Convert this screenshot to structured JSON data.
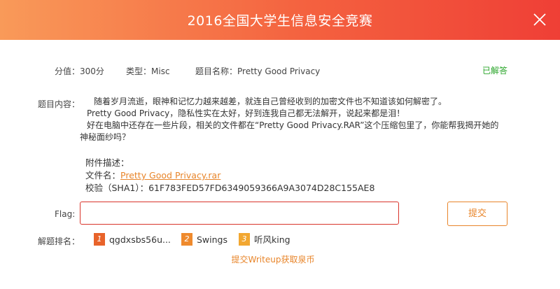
{
  "window": {
    "title": "2016全国大学生信息安全竞赛"
  },
  "meta": {
    "score": "分值：300分",
    "type": "类型：Misc",
    "name": "题目名称：Pretty Good Privacy",
    "status": "已解答"
  },
  "content": {
    "label": "题目内容：",
    "paragraphs": [
      "随着岁月流逝，眼神和记忆力越来越差，就连自己曾经收到的加密文件也不知道该如何解密了。",
      "Pretty Good Privacy，隐私性实在太好，好到连我自己都无法解开，说起来都是泪！",
      "好在电脑中还存在一些片段，相关的文件都在“Pretty Good Privacy.RAR”这个压缩包里了，你能帮我揭开她的神秘面纱吗？"
    ]
  },
  "attachment": {
    "heading": "附件描述：",
    "filename_label": "文件名：",
    "filename": "Pretty Good Privacy.rar",
    "checksum": "校验（SHA1）：61F783FED57FD6349059366A9A3074D28C155AE8"
  },
  "flag": {
    "label": "Flag:",
    "value": "",
    "placeholder": ""
  },
  "submit": {
    "label": "提交"
  },
  "ranking": {
    "label": "解题排名：",
    "items": [
      {
        "rank": "1",
        "name": "qgdxsbs56u...",
        "color": "#e8632a"
      },
      {
        "rank": "2",
        "name": "Swings",
        "color": "#ef8a2d"
      },
      {
        "rank": "3",
        "name": "听风king",
        "color": "#f2a731"
      }
    ]
  },
  "writeup": {
    "label": "提交Writeup获取泉币"
  },
  "colors": {
    "accent": "#e8852a",
    "success": "#2aa52a",
    "error_border": "#d9342b"
  }
}
